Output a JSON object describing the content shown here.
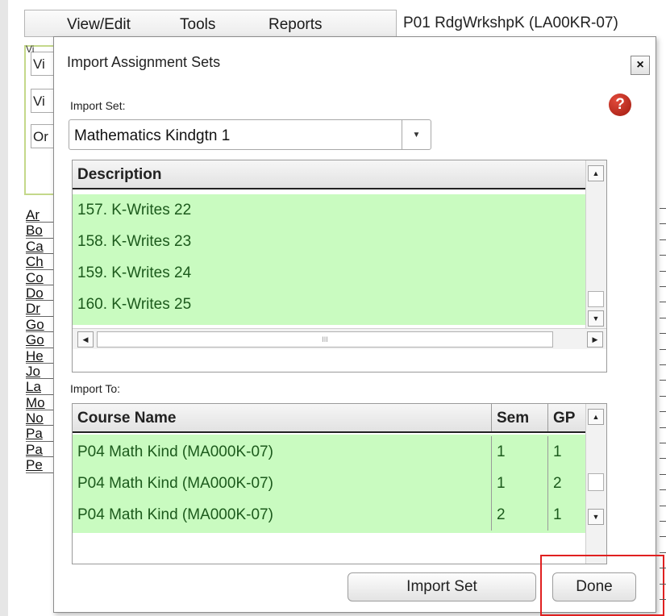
{
  "menu": [
    "View/Edit",
    "Tools",
    "Reports"
  ],
  "section_title": "P01  RdgWrkshpK (LA00KR-07)",
  "bg_tab_label": "Vi",
  "bg_views": [
    "Vi",
    "Vi",
    "Or"
  ],
  "bg_list": [
    "Ar",
    "Bo",
    "Ca",
    "Ch",
    "Co",
    "Do",
    "Dr",
    "Go",
    "Go",
    "He",
    "Jo",
    "La",
    "Mo",
    "No",
    "Pa",
    "Pa",
    "Pe"
  ],
  "dialog": {
    "title": "Import Assignment Sets",
    "close_label": "×",
    "help_label": "?",
    "import_set_label": "Import Set:",
    "import_set_value": "Mathematics Kindgtn 1",
    "description_header": "Description",
    "descriptions": [
      "157. K-Writes 22",
      "158. K-Writes 23",
      "159. K-Writes 24",
      "160. K-Writes 25"
    ],
    "hscroll_grip": "III",
    "import_to_label": "Import To:",
    "columns": {
      "course": "Course Name",
      "sem": "Sem",
      "gp": "GP"
    },
    "courses": [
      {
        "name": "P04   Math Kind (MA000K-07)",
        "sem": "1",
        "gp": "1"
      },
      {
        "name": "P04   Math Kind (MA000K-07)",
        "sem": "1",
        "gp": "2"
      },
      {
        "name": "P04   Math Kind (MA000K-07)",
        "sem": "2",
        "gp": "1"
      }
    ],
    "import_button": "Import Set",
    "done_button": "Done"
  },
  "colors": {
    "row_green": "#c9fbc0",
    "highlight": "#e02020",
    "help_red": "#c0281b"
  }
}
